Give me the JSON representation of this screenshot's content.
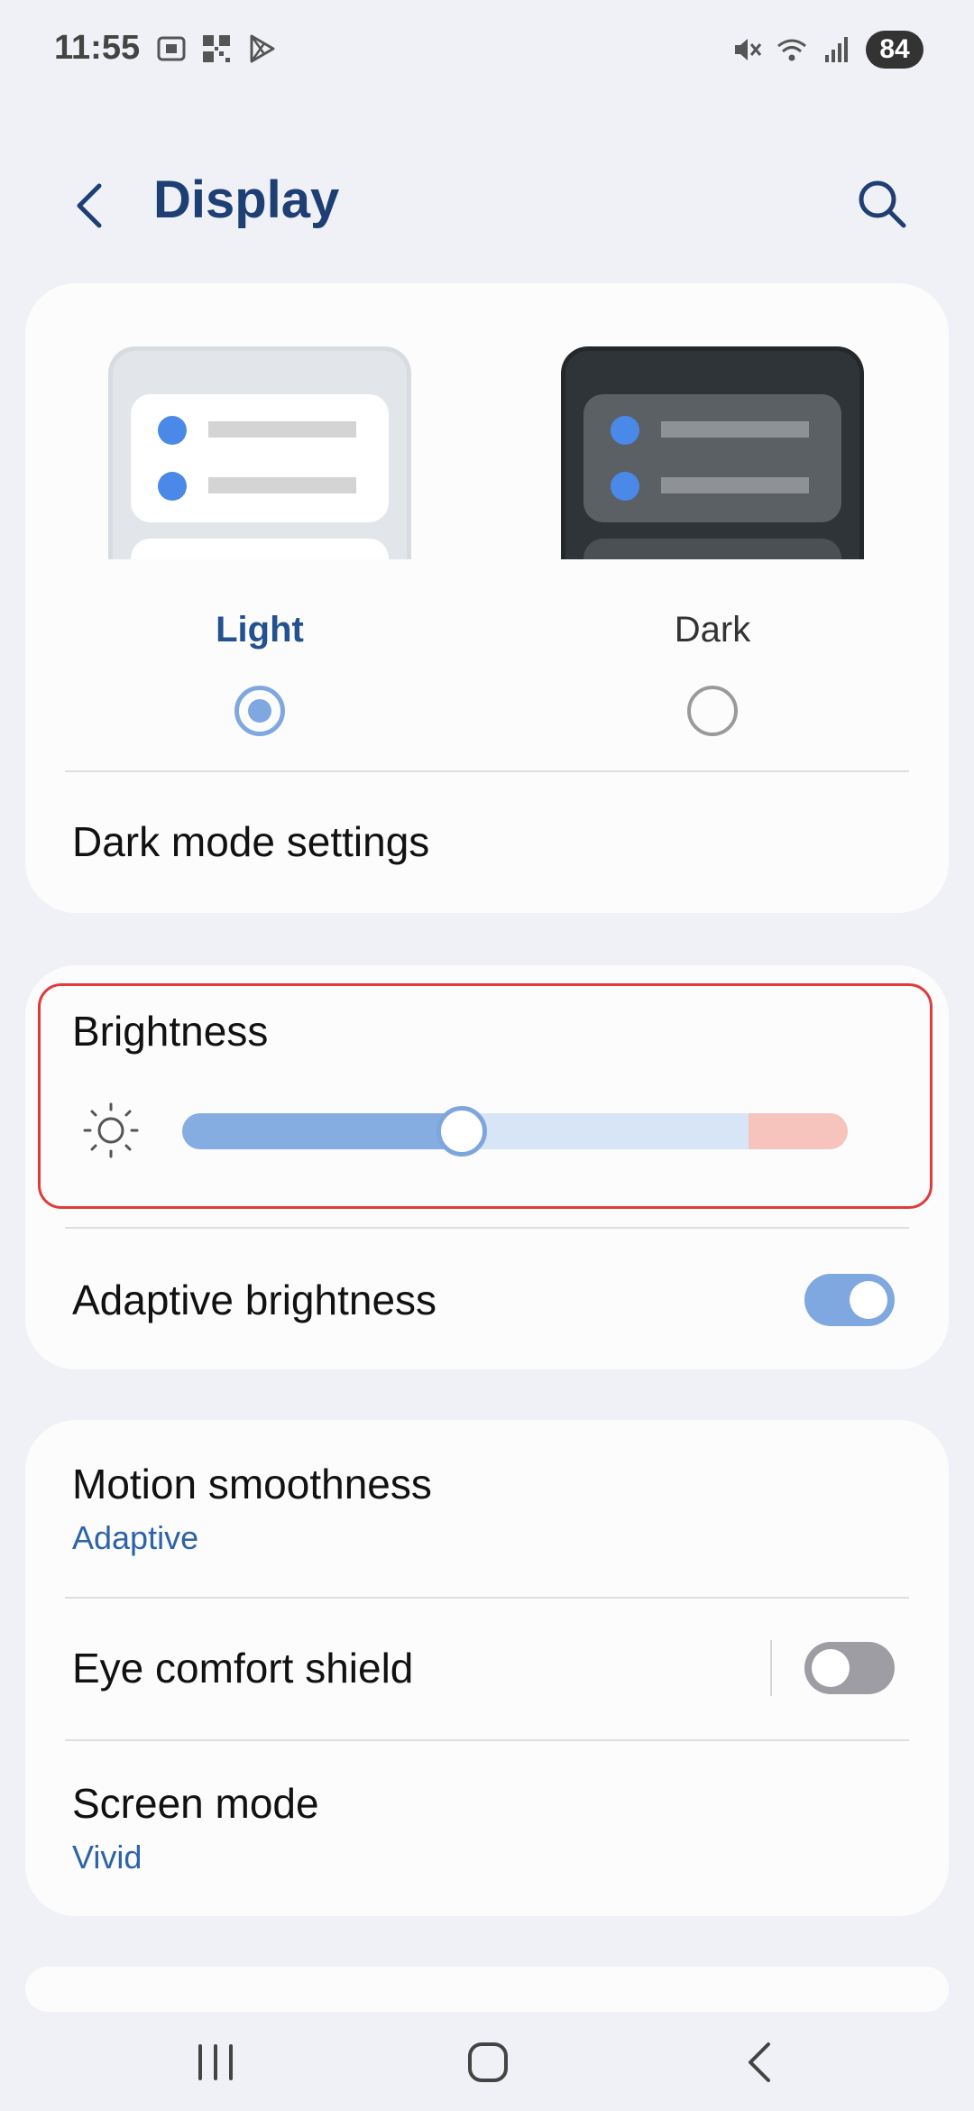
{
  "status_bar": {
    "time": "11:55",
    "battery": "84",
    "left_icons": [
      "screenshot-icon",
      "qr-icon",
      "play-store-icon"
    ],
    "right_icons": [
      "mute-icon",
      "wifi-icon",
      "signal-icon"
    ]
  },
  "header": {
    "title": "Display",
    "back_icon": "back-arrow-icon",
    "search_icon": "search-icon"
  },
  "theme": {
    "options": [
      {
        "label": "Light",
        "selected": true
      },
      {
        "label": "Dark",
        "selected": false
      }
    ],
    "dark_mode_settings_label": "Dark mode settings"
  },
  "brightness": {
    "label": "Brightness",
    "level": 0.42,
    "adaptive_label": "Adaptive brightness",
    "adaptive_on": true
  },
  "settings": {
    "motion_smoothness": {
      "label": "Motion smoothness",
      "value": "Adaptive"
    },
    "eye_comfort": {
      "label": "Eye comfort shield",
      "on": false
    },
    "screen_mode": {
      "label": "Screen mode",
      "value": "Vivid"
    }
  },
  "nav_bar": {
    "icons": [
      "recents-icon",
      "home-icon",
      "back-icon"
    ]
  },
  "colors": {
    "accent": "#7fa8e0",
    "title": "#1d3f73",
    "subtext": "#2d63a8",
    "highlight_border": "#e03a3a"
  }
}
